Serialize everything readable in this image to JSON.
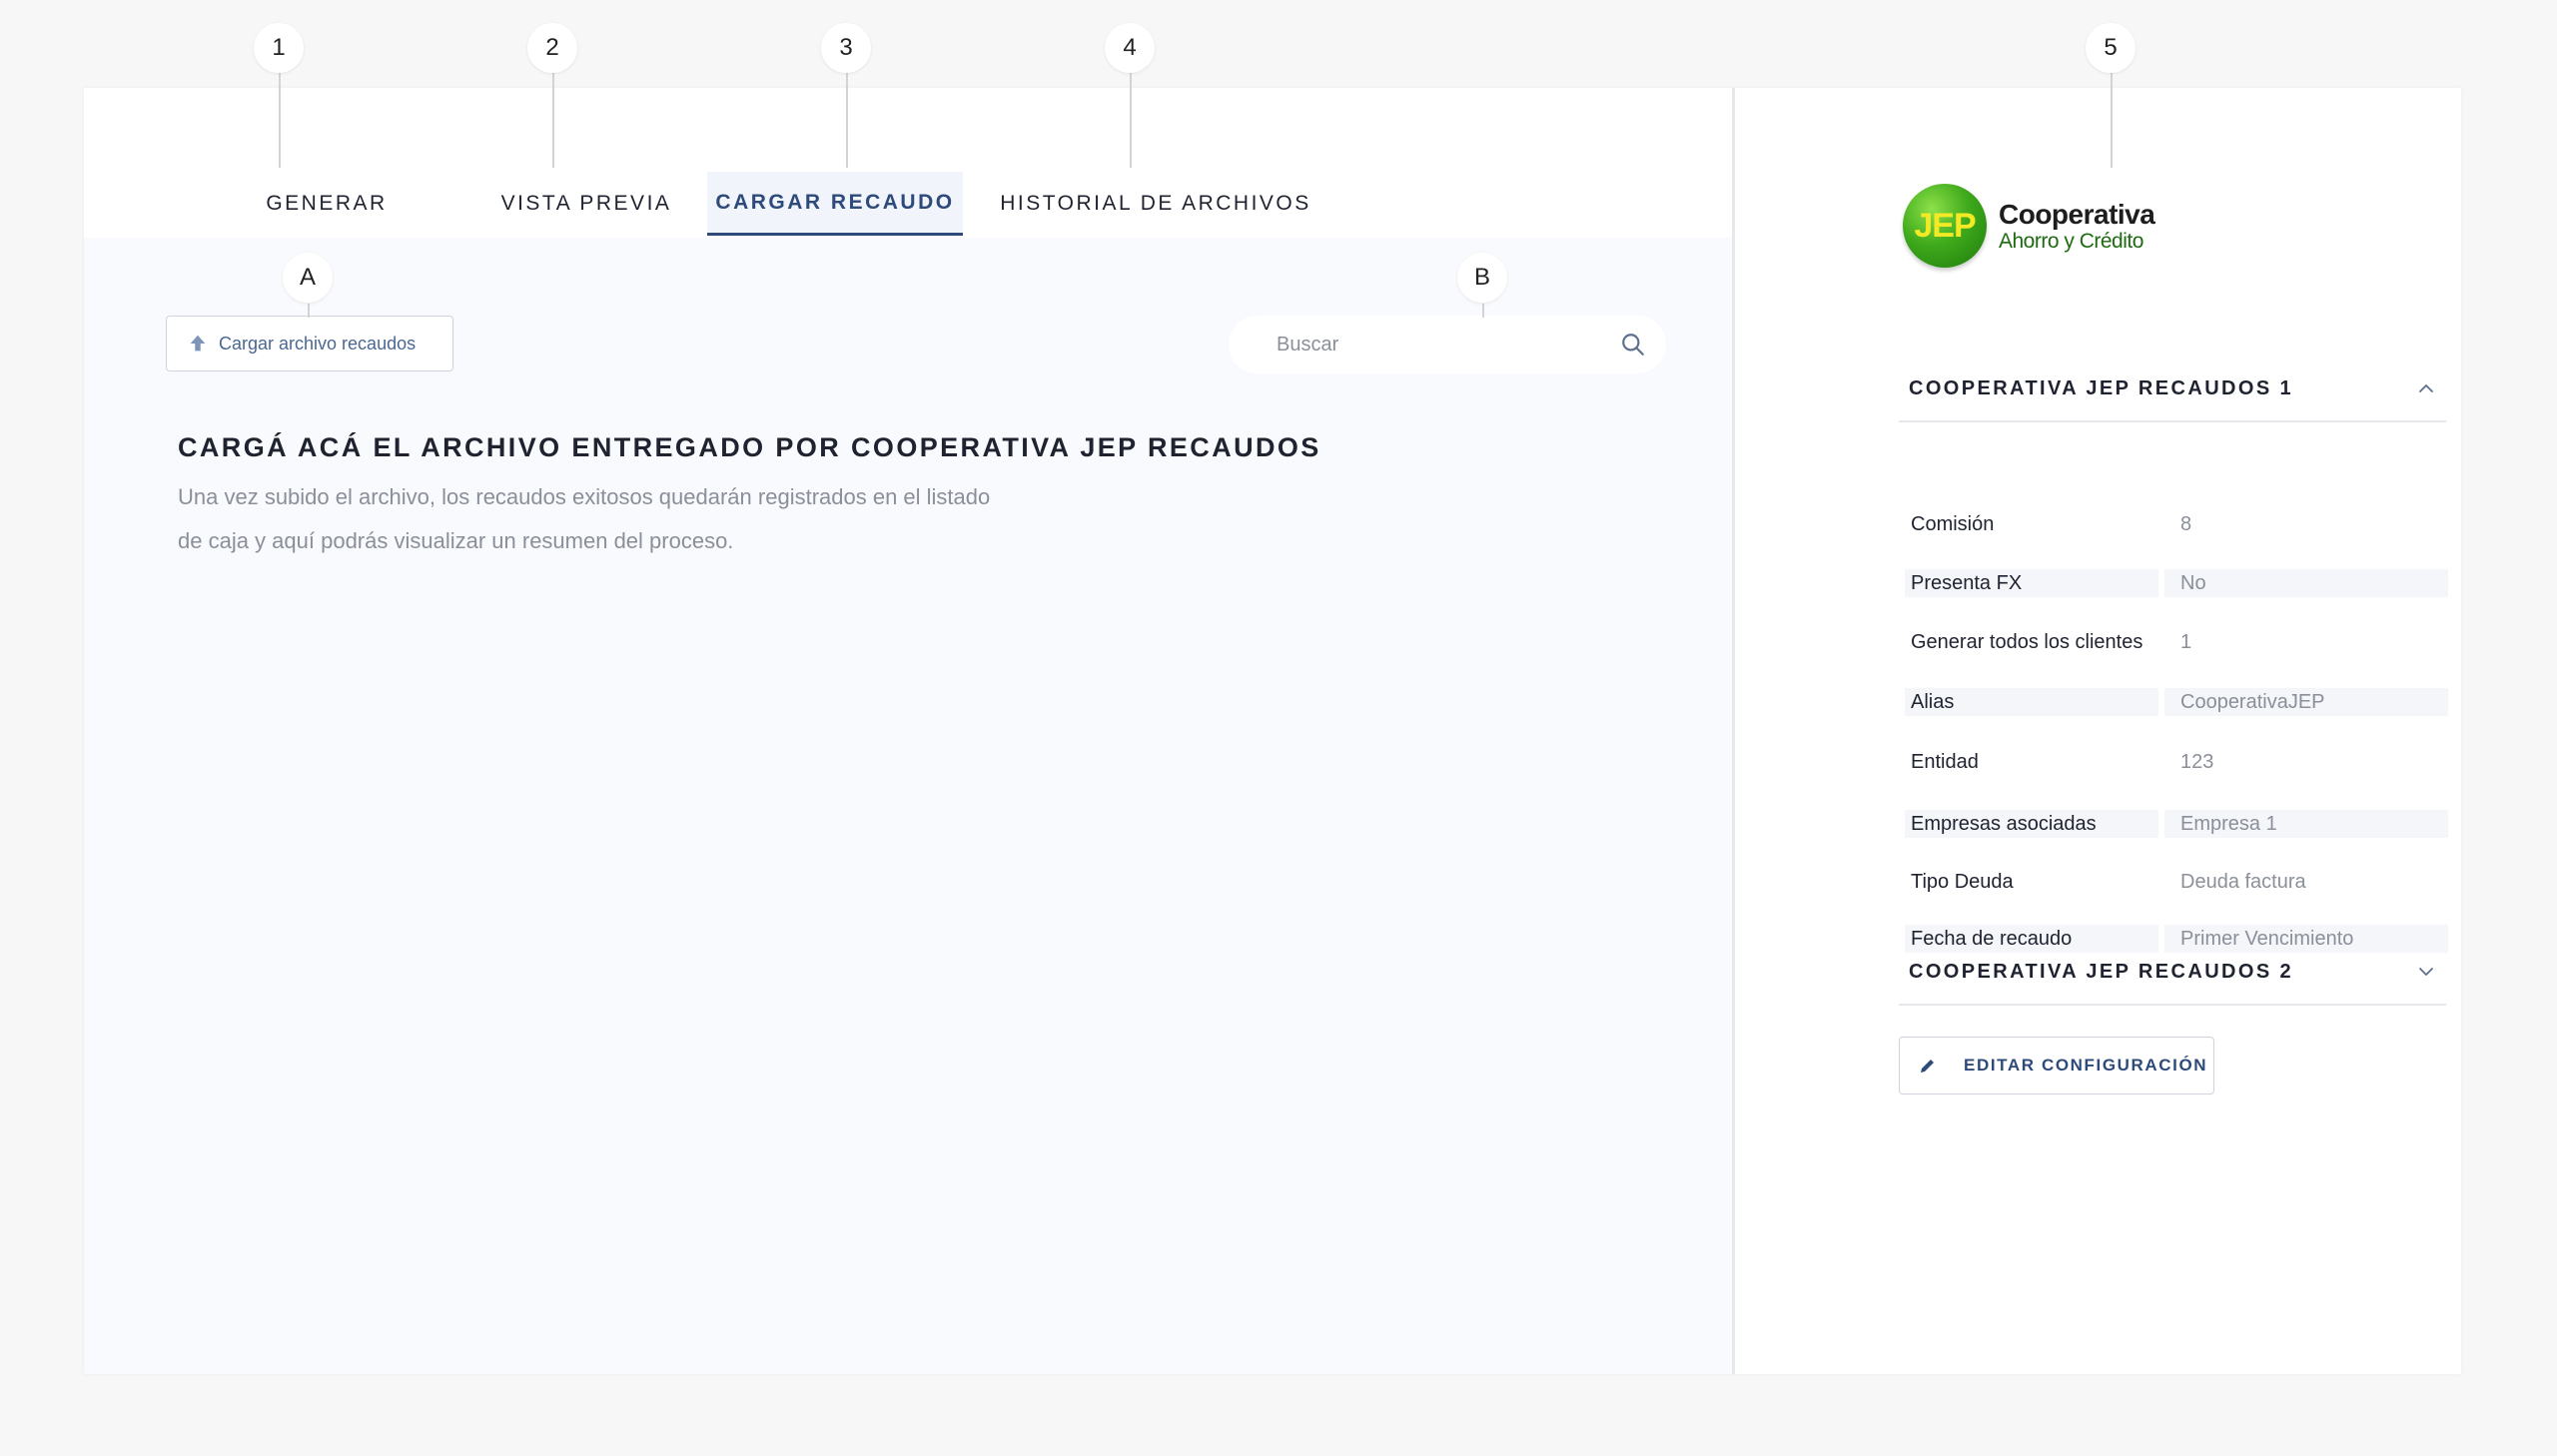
{
  "callouts": {
    "c1": "1",
    "c2": "2",
    "c3": "3",
    "c4": "4",
    "c5": "5",
    "cA": "A",
    "cB": "B"
  },
  "tabs": [
    {
      "label": "GENERAR",
      "active": false
    },
    {
      "label": "VISTA PREVIA",
      "active": false
    },
    {
      "label": "CARGAR RECAUDO",
      "active": true
    },
    {
      "label": "HISTORIAL DE ARCHIVOS",
      "active": false
    }
  ],
  "toolbar": {
    "upload_label": "Cargar archivo recaudos",
    "upload_icon": "upload-arrow-icon",
    "search_placeholder": "Buscar",
    "search_icon": "search-icon"
  },
  "main": {
    "headline": "CARGÁ ACÁ EL ARCHIVO ENTREGADO POR COOPERATIVA JEP RECAUDOS",
    "subtext_line1": "Una vez subido el archivo, los recaudos exitosos quedarán registrados en el listado",
    "subtext_line2": "de caja y aquí podrás visualizar un resumen del proceso."
  },
  "sidebar": {
    "logo": {
      "mark": "JEP",
      "title": "Cooperativa",
      "subtitle": "Ahorro y Crédito"
    },
    "accordion1": {
      "title": "COOPERATIVA JEP RECAUDOS 1",
      "expanded": true
    },
    "props": [
      {
        "label": "Comisión",
        "value": "8"
      },
      {
        "label": "Presenta FX",
        "value": "No"
      },
      {
        "label": "Generar todos los clientes",
        "value": "1"
      },
      {
        "label": "Alias",
        "value": "CooperativaJEP"
      },
      {
        "label": "Entidad",
        "value": "123"
      },
      {
        "label": "Empresas asociadas",
        "value": "Empresa 1"
      },
      {
        "label": "Tipo Deuda",
        "value": "Deuda factura"
      },
      {
        "label": "Fecha de recaudo",
        "value": "Primer Vencimiento"
      }
    ],
    "accordion2": {
      "title": "COOPERATIVA JEP RECAUDOS 2",
      "expanded": false
    },
    "edit_label": "EDITAR CONFIGURACIÓN"
  },
  "colors": {
    "accent": "#2d4a7a",
    "muted_text": "#8a8f99",
    "logo_green": "#3faa1c",
    "logo_yellow": "#f3e924"
  }
}
